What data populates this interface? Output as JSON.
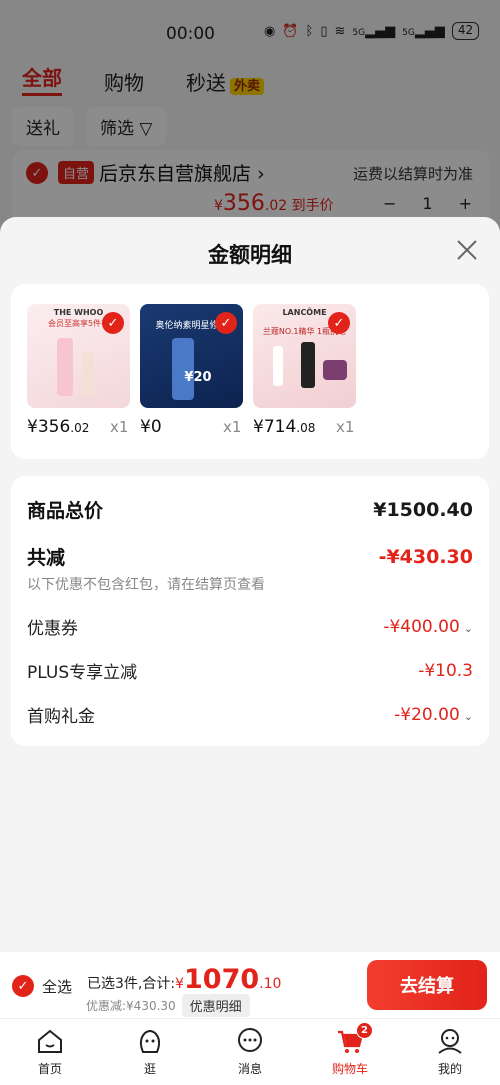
{
  "status": {
    "time": "00:00",
    "battery": "42",
    "net1": "5G",
    "net2": "5G"
  },
  "tabs": [
    {
      "label": "全部"
    },
    {
      "label": "购物"
    },
    {
      "label": "秒送"
    }
  ],
  "tab_badge": "外卖",
  "filters": {
    "gift": "送礼",
    "filter": "筛选"
  },
  "store": {
    "tag": "自营",
    "name": "后京东自营旗舰店",
    "chevron": "›",
    "shipping_note": "运费以结算时为准",
    "price_int": "356",
    "price_dec": ".02",
    "price_suffix": " 到手价",
    "qty": "1",
    "minus": "−",
    "plus": "+"
  },
  "sheet": {
    "title": "金额明细"
  },
  "products": [
    {
      "brand": "THE WHOO",
      "tagline": "会员至高享5件礼",
      "price_int": "356",
      "price_dec": ".02",
      "qty": "x1"
    },
    {
      "brand": "奥伦纳素明星修护",
      "tagline": "¥20",
      "price_int": "0",
      "price_dec": "",
      "qty": "x1"
    },
    {
      "brand": "LANCÔME",
      "tagline": "兰蔻NO.1精华 1瓶抗老",
      "price_int": "714",
      "price_dec": ".08",
      "qty": "x1"
    }
  ],
  "currency": "¥",
  "breakdown": {
    "total_label": "商品总价",
    "total_value": "¥1500.40",
    "discount_label": "共减",
    "discount_value": "-¥430.30",
    "discount_note": "以下优惠不包含红包，请在结算页查看",
    "items": [
      {
        "label": "优惠券",
        "value": "-¥400.00",
        "caret": true
      },
      {
        "label": "PLUS专享立减",
        "value": "-¥10.3",
        "caret": false
      },
      {
        "label": "首购礼金",
        "value": "-¥20.00",
        "caret": true
      }
    ]
  },
  "bottom": {
    "select_all": "全选",
    "selected": "已选3件,合计:",
    "currency": "¥",
    "total_int": "1070",
    "total_dec": ".10",
    "saved": "优惠减:¥430.30",
    "detail_btn": "优惠明细",
    "checkout": "去结算"
  },
  "nav": [
    {
      "label": "首页",
      "icon": "home-icon"
    },
    {
      "label": "逛",
      "icon": "browse-icon"
    },
    {
      "label": "消息",
      "icon": "message-icon"
    },
    {
      "label": "购物车",
      "icon": "cart-icon",
      "badge": "2"
    },
    {
      "label": "我的",
      "icon": "profile-icon"
    }
  ],
  "colors": {
    "accent": "#e2231a",
    "overlay": "rgba(0,0,0,0.45)"
  }
}
